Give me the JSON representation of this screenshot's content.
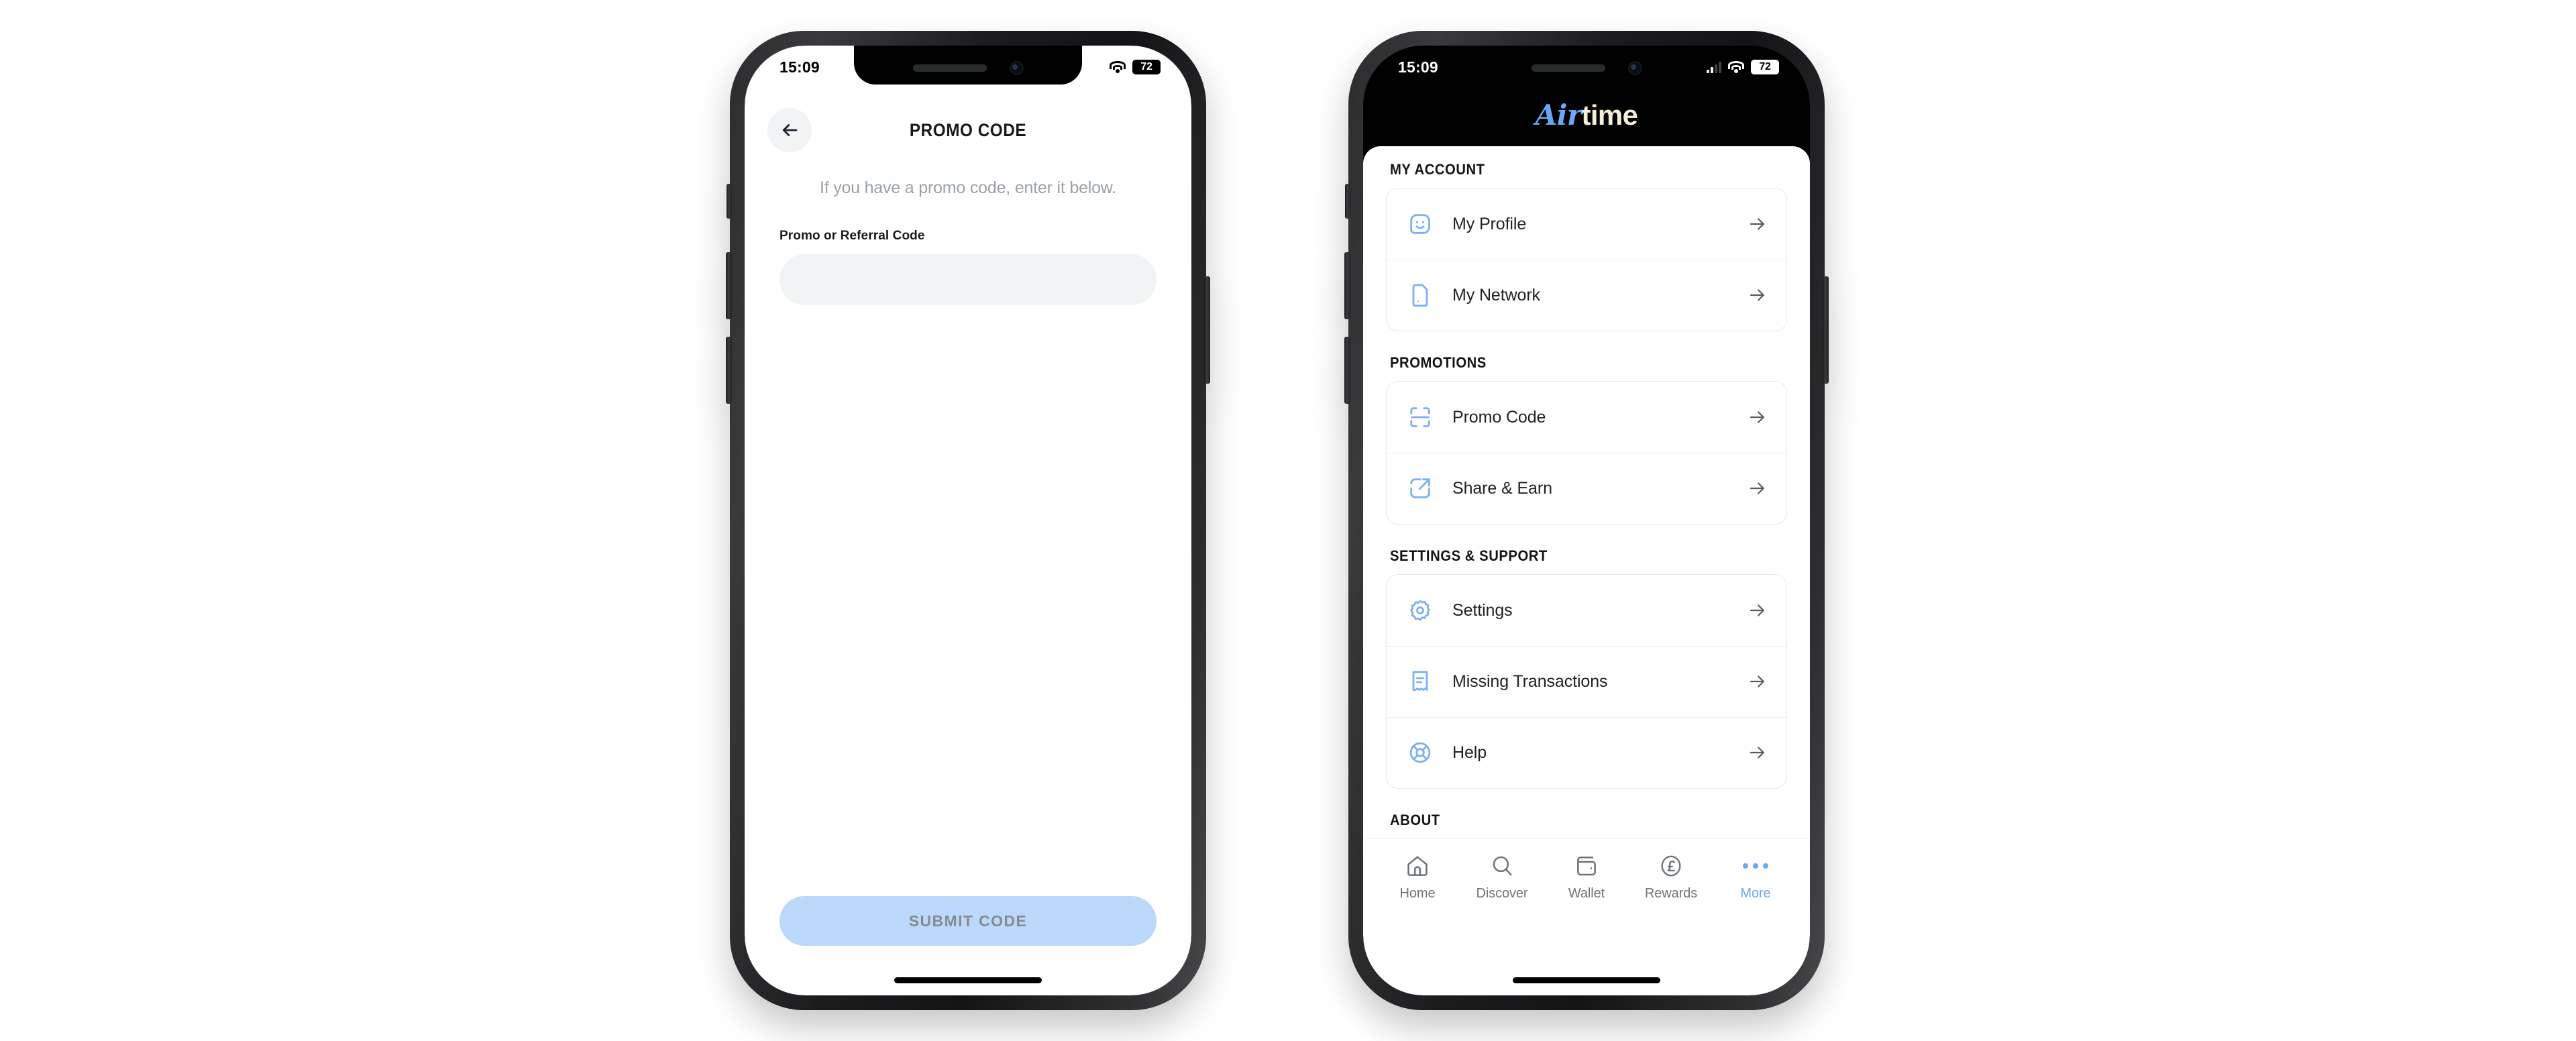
{
  "left_phone": {
    "status_bar": {
      "time": "15:09",
      "battery": "72",
      "wifi_icon": "wifi-icon",
      "battery_icon": "battery-icon"
    },
    "header": {
      "back_icon": "arrow-left-icon",
      "title": "PROMO CODE"
    },
    "subtitle": "If you have a promo code, enter it below.",
    "field": {
      "label": "Promo or Referral Code",
      "value": "",
      "placeholder": ""
    },
    "submit_label": "SUBMIT CODE",
    "colors": {
      "submit_bg": "#bcd8fa",
      "submit_text": "#868b90",
      "field_bg": "#f1f3f4"
    }
  },
  "right_phone": {
    "status_bar": {
      "time": "15:09",
      "battery": "72",
      "signal_icon": "signal-bars-icon",
      "wifi_icon": "wifi-icon",
      "battery_icon": "battery-icon"
    },
    "brand": {
      "part1": "Air",
      "part2": "time"
    },
    "sections": [
      {
        "title": "MY ACCOUNT",
        "items": [
          {
            "label": "My Profile",
            "icon": "smiley-face-icon",
            "arrow": "arrow-right-icon"
          },
          {
            "label": "My Network",
            "icon": "sim-card-icon",
            "arrow": "arrow-right-icon"
          }
        ]
      },
      {
        "title": "PROMOTIONS",
        "items": [
          {
            "label": "Promo Code",
            "icon": "scan-frame-icon",
            "arrow": "arrow-right-icon"
          },
          {
            "label": "Share & Earn",
            "icon": "external-link-icon",
            "arrow": "arrow-right-icon"
          }
        ]
      },
      {
        "title": "SETTINGS & SUPPORT",
        "items": [
          {
            "label": "Settings",
            "icon": "gear-icon",
            "arrow": "arrow-right-icon"
          },
          {
            "label": "Missing Transactions",
            "icon": "receipt-icon",
            "arrow": "arrow-right-icon"
          },
          {
            "label": "Help",
            "icon": "life-ring-icon",
            "arrow": "arrow-right-icon"
          }
        ]
      },
      {
        "title": "ABOUT",
        "items": []
      }
    ],
    "tabs": [
      {
        "label": "Home",
        "icon": "home-icon",
        "active": false
      },
      {
        "label": "Discover",
        "icon": "search-icon",
        "active": false
      },
      {
        "label": "Wallet",
        "icon": "wallet-icon",
        "active": false
      },
      {
        "label": "Rewards",
        "icon": "pound-coin-icon",
        "active": false
      },
      {
        "label": "More",
        "icon": "ellipsis-icon",
        "active": true
      }
    ],
    "colors": {
      "accent": "#6aa8f5",
      "brand_cream": "#f4eeda",
      "header_bg": "#000000"
    }
  }
}
